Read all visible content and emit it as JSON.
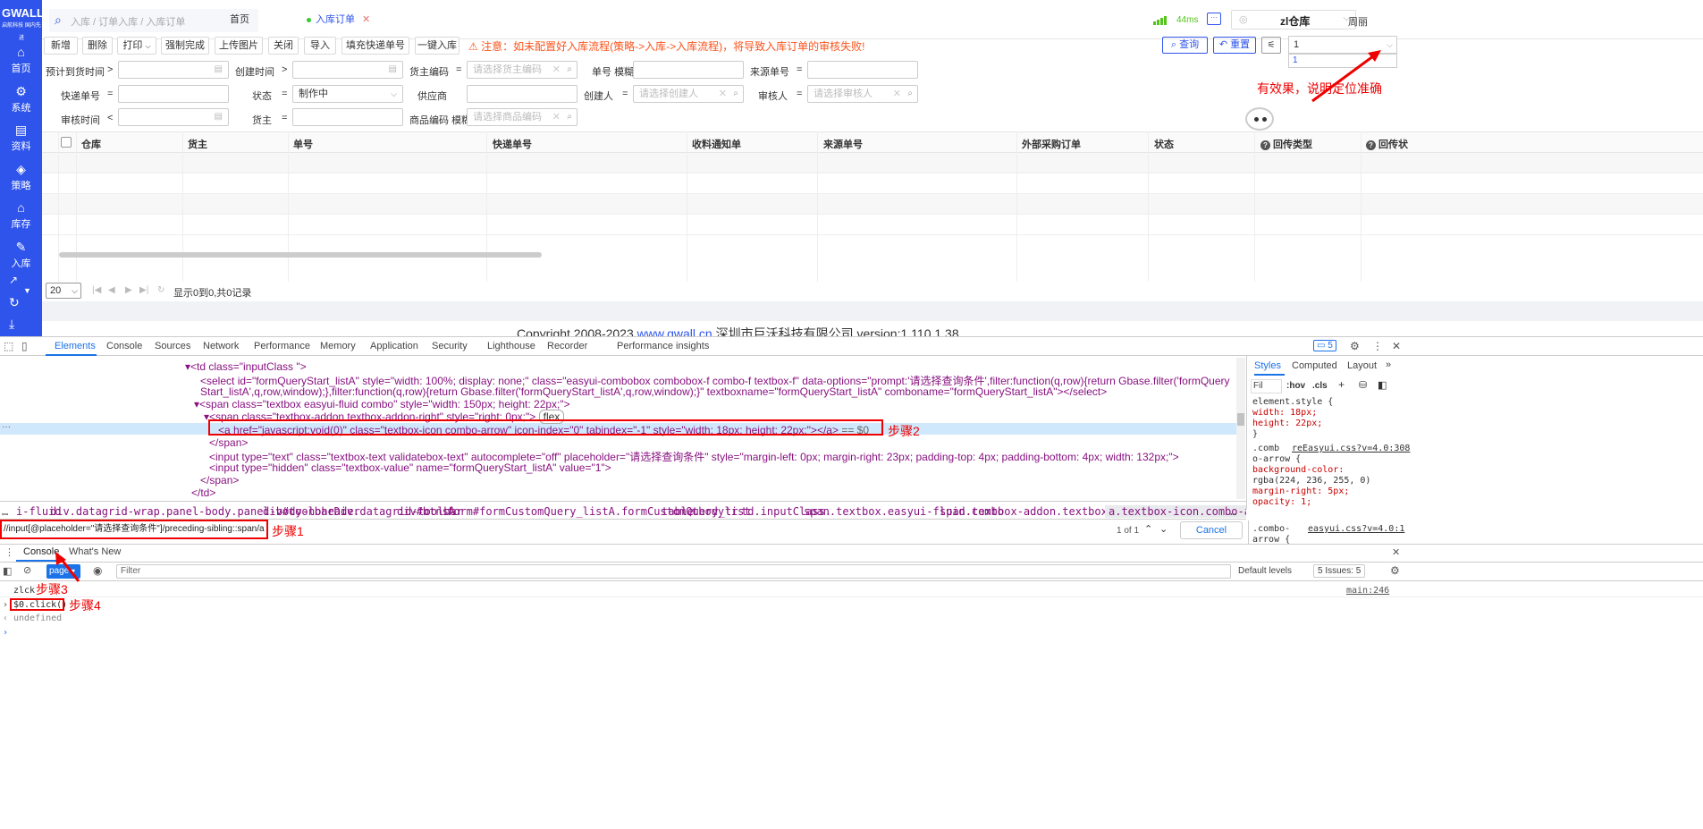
{
  "sidebar": {
    "logo": "GWALL",
    "logo_sub": "启航科技 国内先进",
    "items": [
      {
        "label": "首页",
        "icon": "home-icon"
      },
      {
        "label": "系统",
        "icon": "gear-icon"
      },
      {
        "label": "资料",
        "icon": "document-icon"
      },
      {
        "label": "策略",
        "icon": "layers-icon"
      },
      {
        "label": "库存",
        "icon": "warehouse-icon"
      },
      {
        "label": "入库",
        "icon": "edit-icon"
      }
    ]
  },
  "topbar": {
    "search_placeholder": "入库 / 订单入库 / 入库订单",
    "tabs": [
      {
        "label": "首页"
      },
      {
        "label": "入库订单"
      }
    ],
    "ping": "44ms",
    "warehouse": "zl仓库",
    "user": "周丽"
  },
  "toolbar": {
    "buttons": [
      "新增",
      "删除",
      "打印",
      "强制完成",
      "上传图片",
      "关闭",
      "导入",
      "填充快递单号",
      "一键入库"
    ],
    "notice": "注意：如未配置好入库流程(策略->入库->入库流程)，将导致入库订单的审核失败!",
    "query": "查询",
    "reset": "重置",
    "combo_value": "1",
    "combo_option": "1"
  },
  "form": {
    "expected_date": "预计到货时间",
    "create_time": "创建时间",
    "owner_code": "货主编码",
    "owner_code_ph": "请选择货主编码",
    "order_no": "单号",
    "fuzzy": "模糊",
    "source_no": "来源单号",
    "express_no": "快递单号",
    "status": "状态",
    "status_value": "制作中",
    "supplier": "供应商",
    "creator": "创建人",
    "creator_ph": "请选择创建人",
    "auditor": "审核人",
    "auditor_ph": "请选择审核人",
    "audit_time": "审核时间",
    "owner": "货主",
    "goods_code": "商品编码",
    "goods_code_ph": "请选择商品编码",
    "op_gt": ">",
    "op_lt": "<",
    "op_eq": "="
  },
  "annotation_top": "有效果，说明定位准确",
  "grid": {
    "columns": [
      "仓库",
      "货主",
      "单号",
      "快递单号",
      "收料通知单",
      "来源单号",
      "外部采购订单",
      "状态",
      "回传类型",
      "回传状"
    ]
  },
  "pager": {
    "page_size": "20",
    "info": "显示0到0,共0记录"
  },
  "footer": {
    "prefix": "Copyright   2008-2023",
    "link": "www.gwall.cn",
    "suffix": "深圳市巨沃科技有限公司   version:1.110.1.38"
  },
  "devtools": {
    "tabs": [
      "Elements",
      "Console",
      "Sources",
      "Network",
      "Performance",
      "Memory",
      "Application",
      "Security",
      "Lighthouse",
      "Recorder",
      "Performance insights"
    ],
    "badge": "5",
    "code_lines": [
      "<td class=\"inputClass \">",
      "<select id=\"formQueryStart_listA\" style=\"width: 100%; display: none;\" class=\"easyui-combobox combobox-f combo-f textbox-f\" data-options=\"prompt:'请选择查询条件',filter:function(q,row){return Gbase.filter('formQuery",
      "Start_listA',q,row,window);},filter:function(q,row){return Gbase.filter('formQueryStart_listA',q,row,window);}\" textboxname=\"formQueryStart_listA\" comboname=\"formQueryStart_listA\"></select>",
      "<span class=\"textbox easyui-fluid combo\" style=\"width: 150px; height: 22px;\">",
      "<span class=\"textbox-addon textbox-addon-right\" style=\"right: 0px;\">",
      "<a href=\"javascript:void(0)\" class=\"textbox-icon combo-arrow\" icon-index=\"0\" tabindex=\"-1\" style=\"width: 18px; height: 22px;\"></a>",
      "</span>",
      "<input type=\"text\" class=\"textbox-text validatebox-text\" autocomplete=\"off\" placeholder=\"请选择查询条件\" style=\"margin-left: 0px; margin-right: 23px; padding-top: 4px; padding-bottom: 4px; width: 132px;\">",
      "<input type=\"hidden\" class=\"textbox-value\" name=\"formQueryStart_listA\" value=\"1\">",
      "</span>",
      "</td>"
    ],
    "flex_badge": "flex",
    "selected_suffix": "== $0",
    "step2": "步骤2",
    "styles_tabs": [
      "Styles",
      "Computed",
      "Layout"
    ],
    "styles_filter": "Fil",
    "styles_hov": ":hov",
    "styles_cls": ".cls",
    "style_rules": [
      "element.style {",
      "  width: 18px;",
      "  height: 22px;",
      "}",
      ".comb",
      "o-arrow {",
      "  background-color:",
      "   rgba(224, 236, 255, 0)",
      "  margin-right: 5px;",
      "  opacity: 1;",
      "}",
      ".combo-",
      "arrow {"
    ],
    "style_src1": "reEasyui.css?v=4.0:308",
    "style_src2": "easyui.css?v=4.0:1",
    "breadcrumbs": [
      "i-fluid",
      "div.datagrid-wrap.panel-body.panel-body-noheader",
      "div#toolbarDiv.datagrid-toolbar",
      "div#btnsA",
      "form#formCustomQuery_listA.formCustomQuery_list",
      "table",
      "tbody",
      "tr",
      "td.inputClass.",
      "span.textbox.easyui-fluid.combo",
      "span.textbox-addon.textbox-addon-right",
      "a.textbox-icon.combo-arrow"
    ],
    "find_query": "//input[@placeholder=\"请选择查询条件\"]/preceding-sibling::span/a",
    "step1": "步骤1",
    "find_count": "1 of 1",
    "cancel": "Cancel",
    "drawer_console": "Console",
    "drawer_whatsnew": "What's New",
    "context": "page",
    "filter_ph": "Filter",
    "levels": "Default levels",
    "issues": "5 Issues: 5",
    "log_text": "zlck",
    "log_src": "main:246",
    "step3": "步骤3",
    "cmd": "$0.click()",
    "step4": "步骤4",
    "result": "undefined"
  }
}
